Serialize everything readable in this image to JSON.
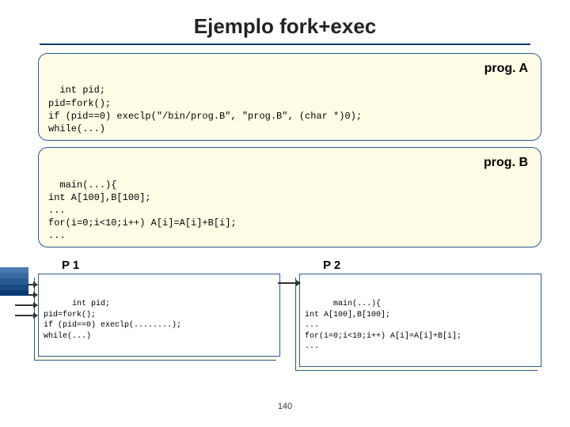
{
  "title": "Ejemplo fork+exec",
  "progA": {
    "label": "prog. A",
    "code": "int pid;\npid=fork();\nif (pid==0) execlp(\"/bin/prog.B\", \"prog.B\", (char *)0);\nwhile(...)"
  },
  "progB": {
    "label": "prog. B",
    "code": "main(...){\nint A[100],B[100];\n...\nfor(i=0;i<10;i++) A[i]=A[i]+B[i];\n..."
  },
  "p1": {
    "title": "P 1",
    "code": "int pid;\npid=fork();\nif (pid==0) execlp(........);\nwhile(...)"
  },
  "p2": {
    "title": "P 2",
    "code": "main(...){\nint A[100],B[100];\n...\nfor(i=0;i<10;i++) A[i]=A[i]+B[i];\n..."
  },
  "page": "140"
}
